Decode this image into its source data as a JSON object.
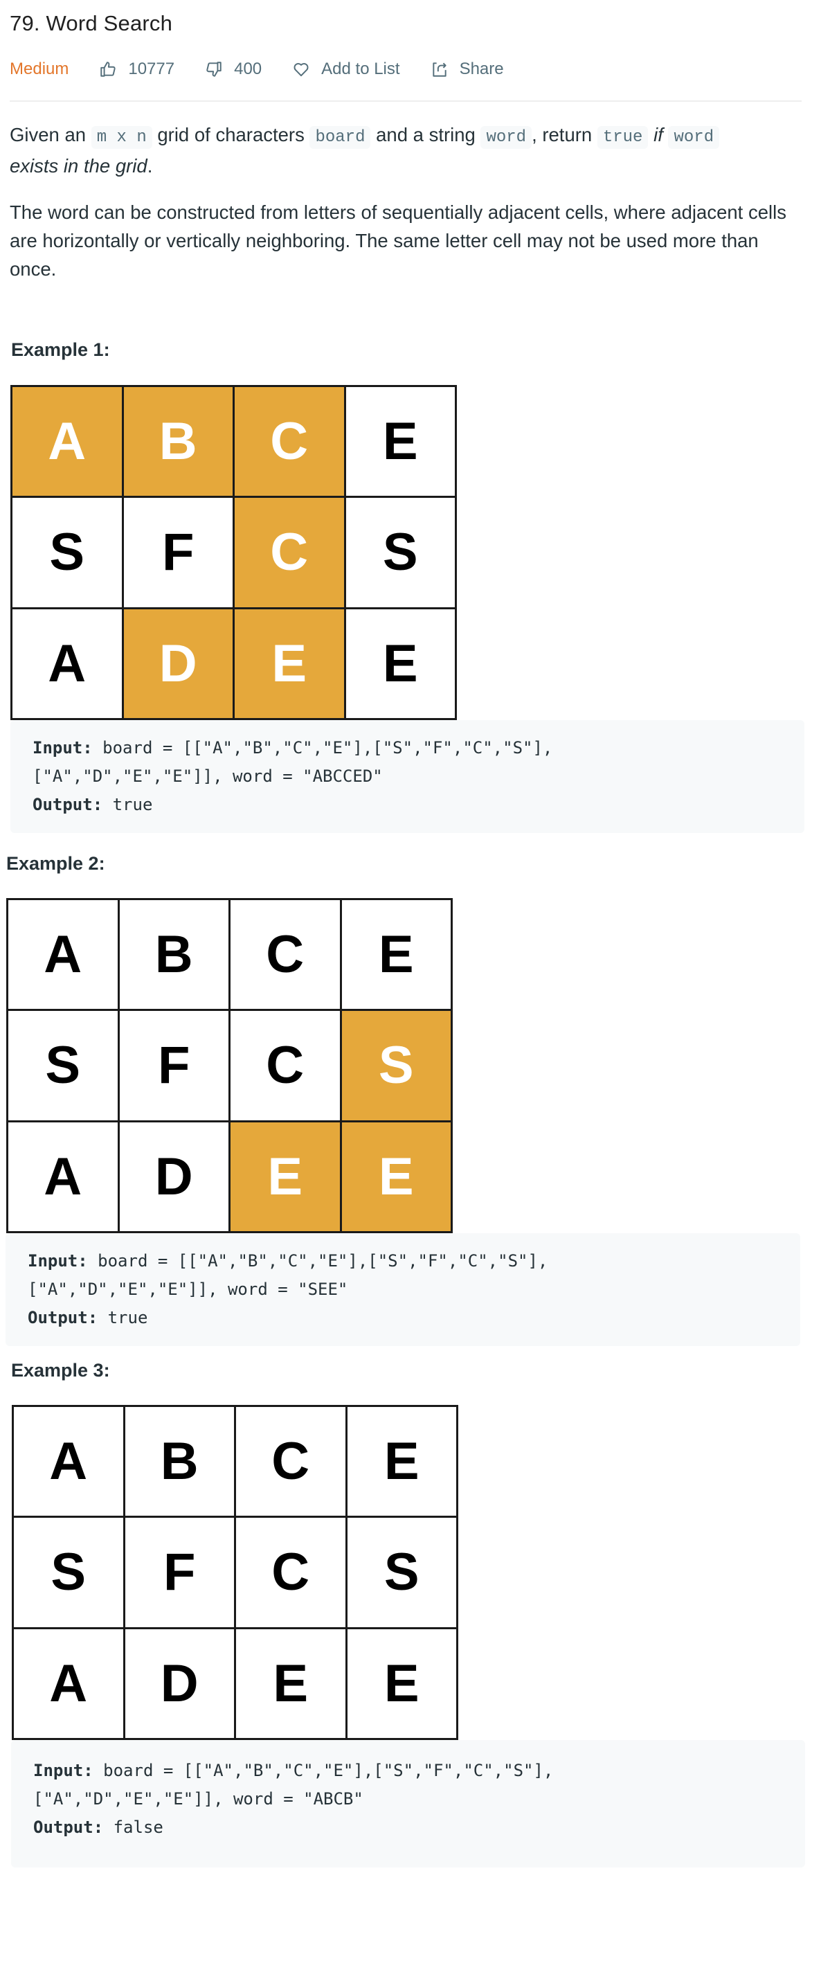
{
  "header": {
    "title": "79. Word Search",
    "difficulty": "Medium",
    "likes": "10777",
    "dislikes": "400",
    "add_to_list": "Add to List",
    "share": "Share"
  },
  "colors": {
    "difficulty": "#e3762a",
    "highlight_cell": "#e5a83b",
    "code_bg": "#f7f9fa",
    "inline_code_text": "#546e7a"
  },
  "description": {
    "p1": {
      "t1": "Given an ",
      "c1": "m x n",
      "t2": " grid of characters ",
      "c2": "board",
      "t3": " and a string ",
      "c3": "word",
      "t4": ", return ",
      "c4": "true",
      "t5": " ",
      "i1": "if",
      "t6": " ",
      "c5": "word",
      "line2": "exists in the grid",
      "end": "."
    },
    "p2": "The word can be constructed from letters of sequentially adjacent cells, where adjacent cells are horizontally or vertically neighboring. The same letter cell may not be used more than once."
  },
  "examples": [
    {
      "label": "Example 1:",
      "board": [
        [
          "A",
          "B",
          "C",
          "E"
        ],
        [
          "S",
          "F",
          "C",
          "S"
        ],
        [
          "A",
          "D",
          "E",
          "E"
        ]
      ],
      "highlight": [
        [
          true,
          true,
          true,
          false
        ],
        [
          false,
          false,
          true,
          false
        ],
        [
          false,
          true,
          true,
          false
        ]
      ],
      "input_label": "Input:",
      "input_line1": " board = [[\"A\",\"B\",\"C\",\"E\"],[\"S\",\"F\",\"C\",\"S\"],",
      "input_line2": "[\"A\",\"D\",\"E\",\"E\"]], word = \"ABCCED\"",
      "output_label": "Output:",
      "output_value": " true"
    },
    {
      "label": "Example 2:",
      "board": [
        [
          "A",
          "B",
          "C",
          "E"
        ],
        [
          "S",
          "F",
          "C",
          "S"
        ],
        [
          "A",
          "D",
          "E",
          "E"
        ]
      ],
      "highlight": [
        [
          false,
          false,
          false,
          false
        ],
        [
          false,
          false,
          false,
          true
        ],
        [
          false,
          false,
          true,
          true
        ]
      ],
      "input_label": "Input:",
      "input_line1": " board = [[\"A\",\"B\",\"C\",\"E\"],[\"S\",\"F\",\"C\",\"S\"],",
      "input_line2": "[\"A\",\"D\",\"E\",\"E\"]], word = \"SEE\"",
      "output_label": "Output:",
      "output_value": " true"
    },
    {
      "label": "Example 3:",
      "board": [
        [
          "A",
          "B",
          "C",
          "E"
        ],
        [
          "S",
          "F",
          "C",
          "S"
        ],
        [
          "A",
          "D",
          "E",
          "E"
        ]
      ],
      "highlight": [
        [
          false,
          false,
          false,
          false
        ],
        [
          false,
          false,
          false,
          false
        ],
        [
          false,
          false,
          false,
          false
        ]
      ],
      "input_label": "Input:",
      "input_line1": " board = [[\"A\",\"B\",\"C\",\"E\"],[\"S\",\"F\",\"C\",\"S\"],",
      "input_line2": "[\"A\",\"D\",\"E\",\"E\"]], word = \"ABCB\"",
      "output_label": "Output:",
      "output_value": " false"
    }
  ]
}
